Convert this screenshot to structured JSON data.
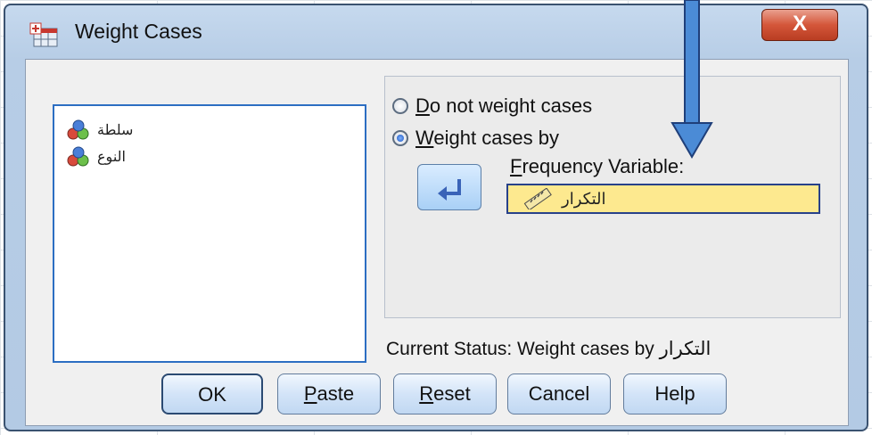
{
  "window": {
    "title": "Weight Cases",
    "close_label": "X"
  },
  "variables": [
    {
      "name": "سلطة",
      "icon": "nominal-variable-icon"
    },
    {
      "name": "النوع",
      "icon": "nominal-variable-icon"
    }
  ],
  "options": {
    "do_not_weight": {
      "label": "Do not weight cases",
      "mnemonic": "D",
      "rest": "o not weight cases",
      "selected": false
    },
    "weight_by": {
      "label": "Weight cases by",
      "mnemonic": "W",
      "rest": "eight cases by",
      "selected": true
    }
  },
  "frequency": {
    "label_mnemonic": "F",
    "label_rest": "requency Variable:",
    "value": "التكرار",
    "icon": "scale-variable-icon"
  },
  "status": {
    "text": "Current Status: Weight cases by التكرار"
  },
  "buttons": {
    "ok": "OK",
    "paste_m": "P",
    "paste_rest": "aste",
    "reset_m": "R",
    "reset_rest": "eset",
    "cancel": "Cancel",
    "help": "Help"
  },
  "colors": {
    "accent": "#3f7fcf",
    "frequency_field": "#fde98f",
    "close_button": "#d4563a"
  }
}
